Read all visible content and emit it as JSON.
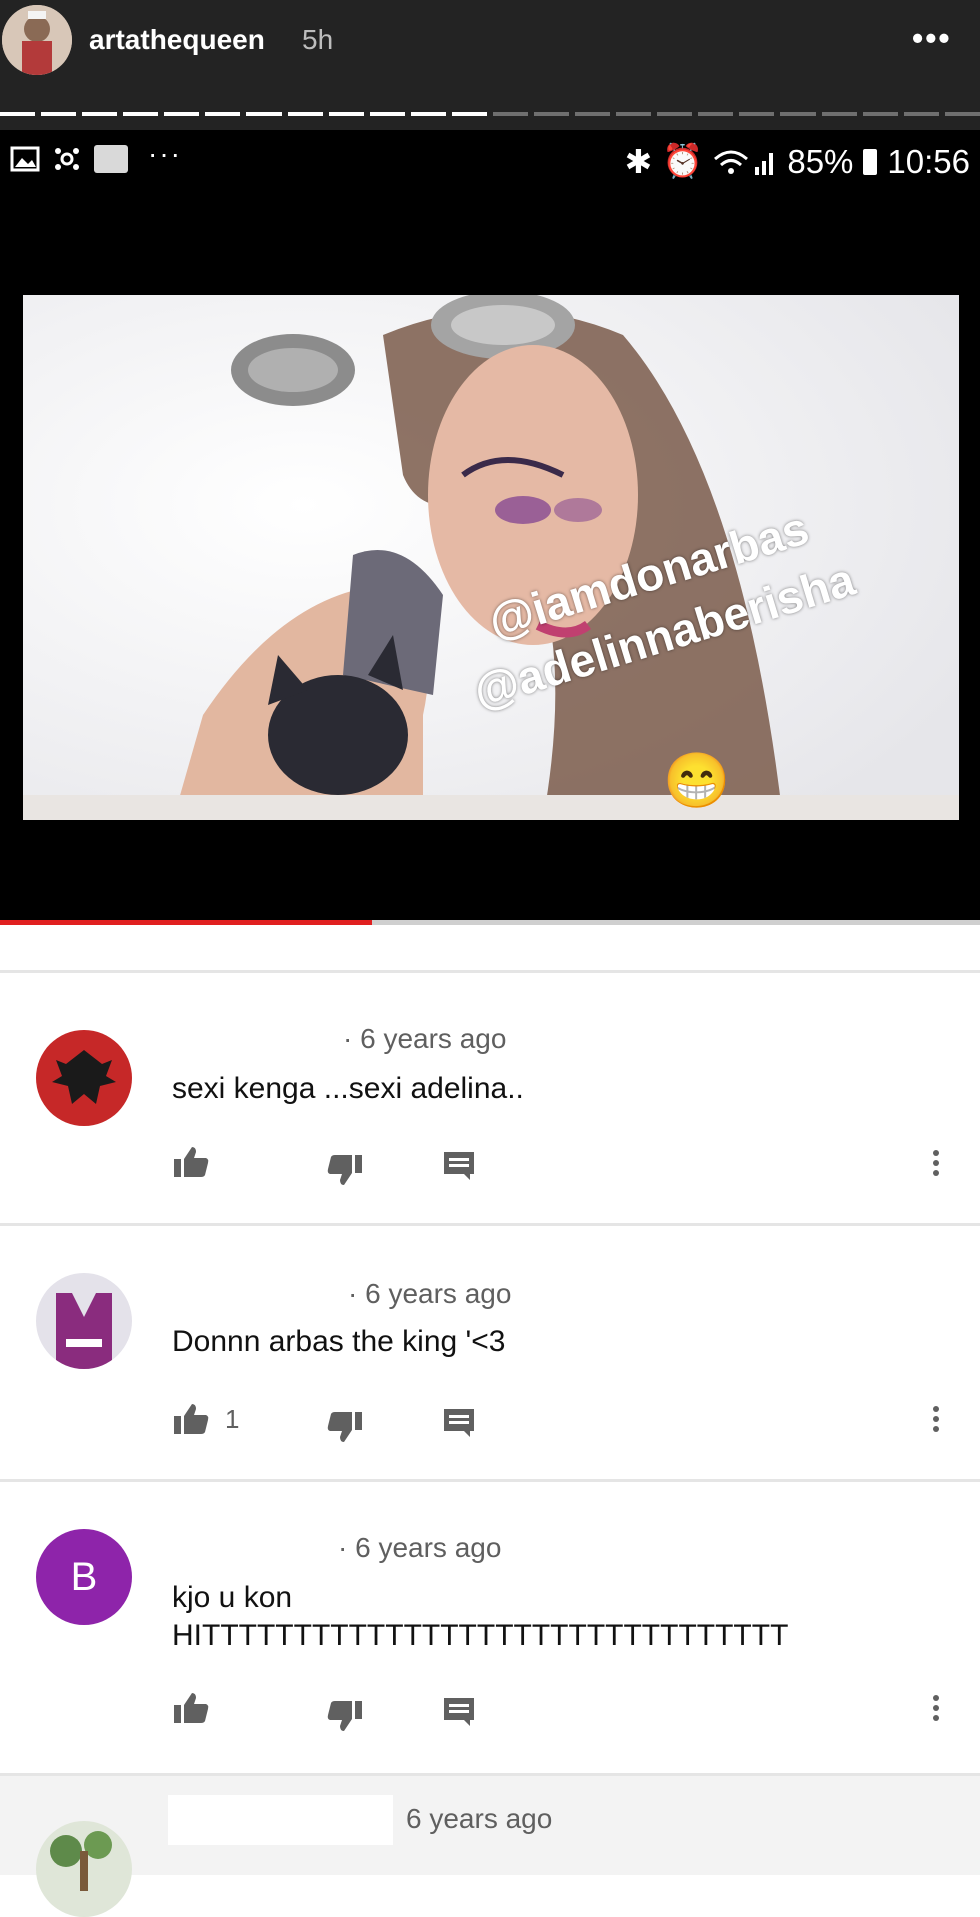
{
  "story": {
    "username": "artathequeen",
    "time": "5h",
    "more_icon": "more-horizontal-icon",
    "segments_total": 24,
    "segments_done": 12
  },
  "status_bar": {
    "battery": "85%",
    "clock": "10:56",
    "left_icons": [
      "image-icon",
      "settings-icon",
      "ebay-icon",
      "more-icon"
    ]
  },
  "video": {
    "mention_1": "@iamdonarbas",
    "mention_2": "@adelinnaberisha",
    "emoji": "😁",
    "progress": 0.38
  },
  "comments": [
    {
      "time": "6 years ago",
      "text": "sexi kenga ...sexi adelina..",
      "likes": ""
    },
    {
      "time": "6 years ago",
      "text": "Donnn arbas the king  '<3",
      "likes": "1"
    },
    {
      "avatar_letter": "B",
      "avatar_color": "#8e24aa",
      "time": "6 years ago",
      "text_line1": "kjo u kon",
      "text_line2": "HITTTTTTTTTTTTTTTTTTTTTTTTTTTTTTTT",
      "likes": ""
    },
    {
      "time": "6 years ago"
    }
  ]
}
